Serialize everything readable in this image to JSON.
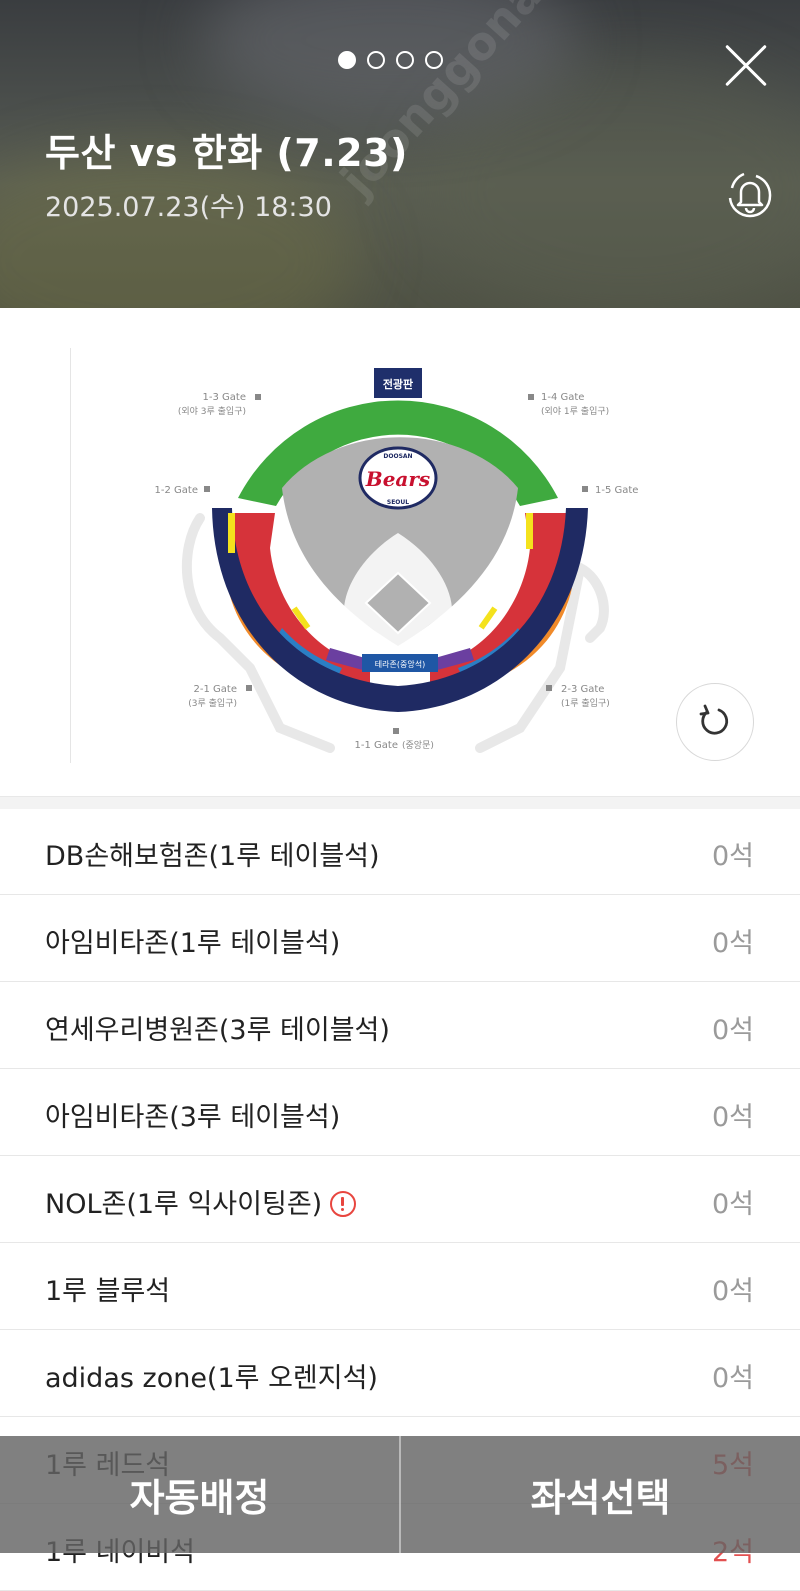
{
  "header": {
    "title": "두산 vs 한화 (7.23)",
    "datetime": "2025.07.23(수) 18:30",
    "pager": {
      "total": 4,
      "active": 0
    },
    "close_icon": "close-icon",
    "bell_icon": "bell-icon",
    "watermark": "joonggonara"
  },
  "map": {
    "scoreboard_label": "전광판",
    "logo_text": "Bears",
    "logo_top": "DOOSAN",
    "logo_bottom": "SEOUL",
    "terrace_label": "테라존(중앙석)",
    "gates": [
      {
        "name": "1-3 Gate",
        "sub": "(외야 3루 출입구)"
      },
      {
        "name": "1-4 Gate",
        "sub": "(외야 1루 출입구)"
      },
      {
        "name": "1-2 Gate",
        "sub": ""
      },
      {
        "name": "1-5 Gate",
        "sub": ""
      },
      {
        "name": "2-1 Gate",
        "sub": "(3루 출입구)"
      },
      {
        "name": "2-3 Gate",
        "sub": "(1루 출입구)"
      },
      {
        "name": "1-1 Gate",
        "sub": "(중앙문)"
      }
    ],
    "refresh_icon": "refresh-icon"
  },
  "zones": [
    {
      "name": "DB손해보험존(1루 테이블석)",
      "count": "0석",
      "alert": false
    },
    {
      "name": "아임비타존(1루 테이블석)",
      "count": "0석",
      "alert": false
    },
    {
      "name": "연세우리병원존(3루 테이블석)",
      "count": "0석",
      "alert": false
    },
    {
      "name": "아임비타존(3루 테이블석)",
      "count": "0석",
      "alert": false
    },
    {
      "name": "NOL존(1루 익사이팅존)",
      "count": "0석",
      "alert": true
    },
    {
      "name": "1루 블루석",
      "count": "0석",
      "alert": false
    },
    {
      "name": "adidas zone(1루 오렌지석)",
      "count": "0석",
      "alert": false
    },
    {
      "name": "1루 레드석",
      "count": "5석",
      "alert": false
    },
    {
      "name": "1루 네이비석",
      "count": "2석",
      "alert": false
    }
  ],
  "buttons": {
    "auto_assign": "자동배정",
    "select_seat": "좌석선택"
  }
}
